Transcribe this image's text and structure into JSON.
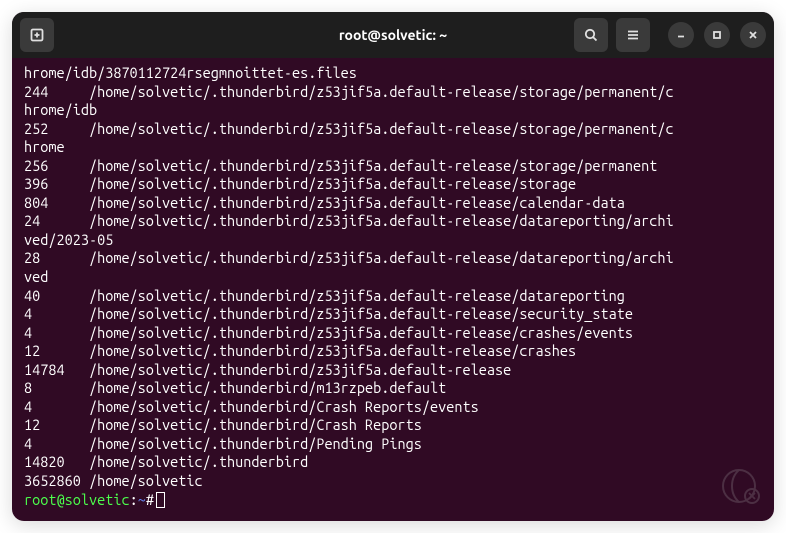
{
  "titlebar": {
    "title": "root@solvetic: ~",
    "new_tab_icon": "new-tab-icon",
    "search_icon": "search-icon",
    "menu_icon": "menu-icon",
    "minimize_icon": "minimize-icon",
    "maximize_icon": "maximize-icon",
    "close_icon": "close-icon"
  },
  "terminal": {
    "lines": [
      "hrome/idb/3870112724rsegmnoittet-es.files",
      "244     /home/solvetic/.thunderbird/z53jif5a.default-release/storage/permanent/c",
      "hrome/idb",
      "252     /home/solvetic/.thunderbird/z53jif5a.default-release/storage/permanent/c",
      "hrome",
      "256     /home/solvetic/.thunderbird/z53jif5a.default-release/storage/permanent",
      "396     /home/solvetic/.thunderbird/z53jif5a.default-release/storage",
      "804     /home/solvetic/.thunderbird/z53jif5a.default-release/calendar-data",
      "24      /home/solvetic/.thunderbird/z53jif5a.default-release/datareporting/archi",
      "ved/2023-05",
      "28      /home/solvetic/.thunderbird/z53jif5a.default-release/datareporting/archi",
      "ved",
      "40      /home/solvetic/.thunderbird/z53jif5a.default-release/datareporting",
      "4       /home/solvetic/.thunderbird/z53jif5a.default-release/security_state",
      "4       /home/solvetic/.thunderbird/z53jif5a.default-release/crashes/events",
      "12      /home/solvetic/.thunderbird/z53jif5a.default-release/crashes",
      "14784   /home/solvetic/.thunderbird/z53jif5a.default-release",
      "8       /home/solvetic/.thunderbird/m13rzpeb.default",
      "4       /home/solvetic/.thunderbird/Crash Reports/events",
      "12      /home/solvetic/.thunderbird/Crash Reports",
      "4       /home/solvetic/.thunderbird/Pending Pings",
      "14820   /home/solvetic/.thunderbird",
      "3652860 /home/solvetic"
    ],
    "prompt": {
      "user_host": "root@solvetic",
      "colon": ":",
      "path": "~",
      "hash": "#"
    }
  }
}
